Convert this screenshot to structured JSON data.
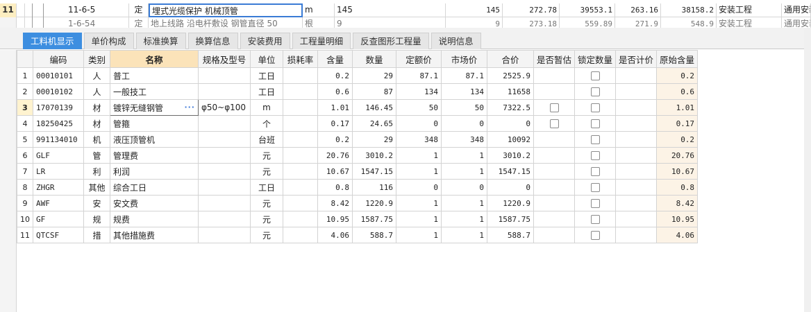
{
  "top_grid": {
    "row1": {
      "row_num": "11",
      "code": "11-6-5",
      "type": "定",
      "name": "埋式光缆保护 机械顶管",
      "unit": "m",
      "expr": "145",
      "qty": "145",
      "unit_price": "272.78",
      "total": "39553.1",
      "v1": "263.16",
      "v2": "38158.2",
      "category": "安装工程",
      "remark": "通用安装"
    },
    "row2": {
      "row_num": "",
      "code": "1-6-54",
      "type": "定",
      "name": "地上线路 沿电杆敷设 钢管直径 50",
      "unit": "根",
      "expr": "9",
      "qty": "9",
      "unit_price": "273.18",
      "total": "559.89",
      "v1": "271.9",
      "v2": "548.9",
      "category": "安装工程",
      "remark": "通用安装"
    }
  },
  "tabs": [
    {
      "label": "工料机显示",
      "active": true
    },
    {
      "label": "单价构成",
      "active": false
    },
    {
      "label": "标准换算",
      "active": false
    },
    {
      "label": "换算信息",
      "active": false
    },
    {
      "label": "安装费用",
      "active": false
    },
    {
      "label": "工程量明细",
      "active": false
    },
    {
      "label": "反查图形工程量",
      "active": false
    },
    {
      "label": "说明信息",
      "active": false
    }
  ],
  "table": {
    "headers": [
      "编码",
      "类别",
      "名称",
      "规格及型号",
      "单位",
      "损耗率",
      "含量",
      "数量",
      "定额价",
      "市场价",
      "合价",
      "是否暂估",
      "锁定数量",
      "是否计价",
      "原始含量"
    ],
    "rows": [
      {
        "n": "1",
        "code": "00010101",
        "cat": "人",
        "name": "普工",
        "spec": "",
        "unit": "工日",
        "loss": "",
        "content": "0.2",
        "qty": "29",
        "quota": "87.1",
        "market": "87.1",
        "total": "2525.9",
        "est": false,
        "lock": true,
        "priced": false,
        "orig": "0.2"
      },
      {
        "n": "2",
        "code": "00010102",
        "cat": "人",
        "name": "一般技工",
        "spec": "",
        "unit": "工日",
        "loss": "",
        "content": "0.6",
        "qty": "87",
        "quota": "134",
        "market": "134",
        "total": "11658",
        "est": false,
        "lock": true,
        "priced": false,
        "orig": "0.6"
      },
      {
        "n": "3",
        "code": "17070139",
        "cat": "材",
        "name": "镀锌无缝钢管",
        "spec": "φ50~φ100",
        "unit": "m",
        "loss": "",
        "content": "1.01",
        "qty": "146.45",
        "quota": "50",
        "market": "50",
        "total": "7322.5",
        "est": true,
        "lock": true,
        "priced": false,
        "orig": "1.01"
      },
      {
        "n": "4",
        "code": "18250425",
        "cat": "材",
        "name": "管箍",
        "spec": "",
        "unit": "个",
        "loss": "",
        "content": "0.17",
        "qty": "24.65",
        "quota": "0",
        "market": "0",
        "total": "0",
        "est": true,
        "lock": true,
        "priced": false,
        "orig": "0.17"
      },
      {
        "n": "5",
        "code": "991134010",
        "cat": "机",
        "name": "液压顶管机",
        "spec": "",
        "unit": "台班",
        "loss": "",
        "content": "0.2",
        "qty": "29",
        "quota": "348",
        "market": "348",
        "total": "10092",
        "est": false,
        "lock": true,
        "priced": false,
        "orig": "0.2"
      },
      {
        "n": "6",
        "code": "GLF",
        "cat": "管",
        "name": "管理费",
        "spec": "",
        "unit": "元",
        "loss": "",
        "content": "20.76",
        "qty": "3010.2",
        "quota": "1",
        "market": "1",
        "total": "3010.2",
        "est": false,
        "lock": true,
        "priced": false,
        "orig": "20.76"
      },
      {
        "n": "7",
        "code": "LR",
        "cat": "利",
        "name": "利润",
        "spec": "",
        "unit": "元",
        "loss": "",
        "content": "10.67",
        "qty": "1547.15",
        "quota": "1",
        "market": "1",
        "total": "1547.15",
        "est": false,
        "lock": true,
        "priced": false,
        "orig": "10.67"
      },
      {
        "n": "8",
        "code": "ZHGR",
        "cat": "其他",
        "name": "综合工日",
        "spec": "",
        "unit": "工日",
        "loss": "",
        "content": "0.8",
        "qty": "116",
        "quota": "0",
        "market": "0",
        "total": "0",
        "est": false,
        "lock": true,
        "priced": false,
        "orig": "0.8"
      },
      {
        "n": "9",
        "code": "AWF",
        "cat": "安",
        "name": "安文费",
        "spec": "",
        "unit": "元",
        "loss": "",
        "content": "8.42",
        "qty": "1220.9",
        "quota": "1",
        "market": "1",
        "total": "1220.9",
        "est": false,
        "lock": true,
        "priced": false,
        "orig": "8.42"
      },
      {
        "n": "10",
        "code": "GF",
        "cat": "规",
        "name": "规费",
        "spec": "",
        "unit": "元",
        "loss": "",
        "content": "10.95",
        "qty": "1587.75",
        "quota": "1",
        "market": "1",
        "total": "1587.75",
        "est": false,
        "lock": true,
        "priced": false,
        "orig": "10.95"
      },
      {
        "n": "11",
        "code": "QTCSF",
        "cat": "措",
        "name": "其他措施费",
        "spec": "",
        "unit": "元",
        "loss": "",
        "content": "4.06",
        "qty": "588.7",
        "quota": "1",
        "market": "1",
        "total": "588.7",
        "est": false,
        "lock": true,
        "priced": false,
        "orig": "4.06"
      }
    ],
    "selected_row": "3",
    "cell_button_glyph": "···"
  }
}
